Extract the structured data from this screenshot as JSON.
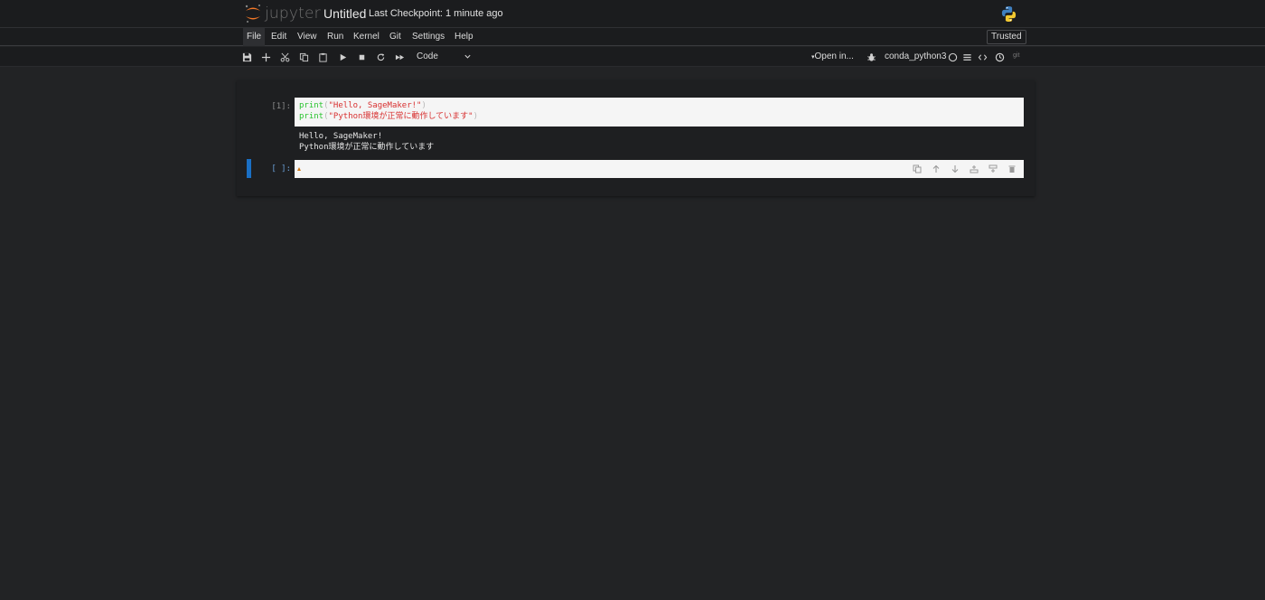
{
  "header": {
    "logo_text": "jupyter",
    "notebook_title": "Untitled",
    "checkpoint": "Last Checkpoint: 1 minute ago",
    "kernel_logo_icon": "python-icon"
  },
  "menubar": {
    "items": [
      {
        "label": "File",
        "active": true
      },
      {
        "label": "Edit"
      },
      {
        "label": "View"
      },
      {
        "label": "Run"
      },
      {
        "label": "Kernel"
      },
      {
        "label": "Git"
      },
      {
        "label": "Settings"
      },
      {
        "label": "Help"
      }
    ],
    "trusted": "Trusted"
  },
  "toolbar": {
    "buttons": [
      "save-icon",
      "add-cell-icon",
      "cut-icon",
      "copy-icon",
      "paste-icon",
      "run-icon",
      "stop-icon",
      "restart-icon",
      "fast-forward-icon"
    ],
    "cell_type": "Code",
    "open_in": "Open in...",
    "kernel_name": "conda_python3",
    "right_icons": [
      "bug-icon",
      "kernel-status-circle-icon",
      "toc-icon",
      "code-format-icon",
      "clock-icon"
    ],
    "git_label": "git"
  },
  "cells": [
    {
      "prompt": "[1]:",
      "code_lines": [
        {
          "func": "print",
          "arg": "\"Hello, SageMaker!\""
        },
        {
          "func": "print",
          "arg": "\"Python環境が正常に動作しています\""
        }
      ],
      "output_lines": [
        "Hello, SageMaker!",
        "Python環境が正常に動作しています"
      ]
    },
    {
      "prompt": "[ ]:",
      "active": true,
      "code_lines": [],
      "cell_tools": [
        "duplicate-icon",
        "move-up-icon",
        "move-down-icon",
        "insert-below-icon",
        "insert-above-icon",
        "delete-icon"
      ]
    }
  ],
  "colors": {
    "background": "#222325",
    "header": "#1b1c1e",
    "accent_orange": "#f37726",
    "active_cell_bar": "#1a6fc4",
    "keyword_green": "#29c42f",
    "string_red": "#d83030"
  }
}
